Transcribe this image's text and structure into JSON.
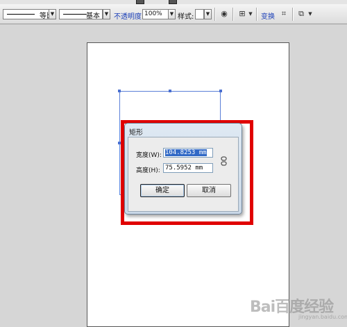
{
  "toolbar": {
    "stroke_profile_label": "等比",
    "brush_label": "基本",
    "opacity_label": "不透明度:",
    "opacity_value": "100%",
    "style_label": "样式:",
    "transform_label": "变换"
  },
  "dialog": {
    "title": "矩形",
    "width_label": "宽度(W):",
    "width_value": "104.8253 mm",
    "height_label": "高度(H):",
    "height_value": "75.5952 mm",
    "ok_label": "确定",
    "cancel_label": "取消"
  },
  "watermark": {
    "logo_text": "Bai百度经验",
    "sub_text": "jingyan.baidu.com"
  },
  "colors": {
    "highlight": "#e00000",
    "selection": "#5a7fd8"
  }
}
